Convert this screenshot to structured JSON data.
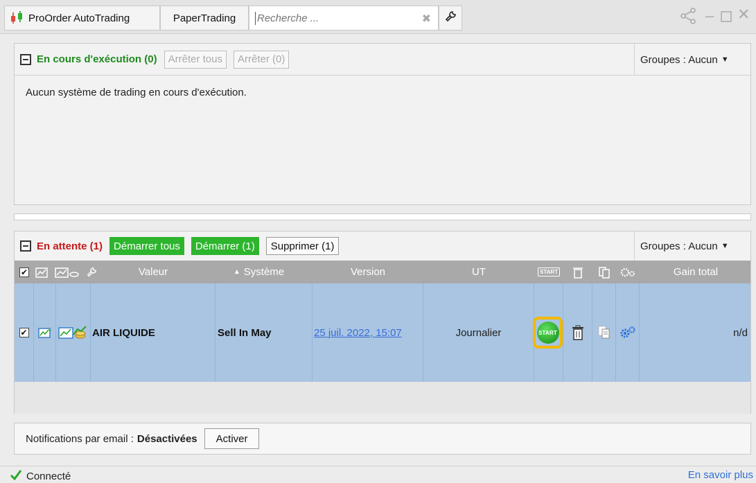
{
  "titlebar": {
    "tabs": [
      "ProOrder AutoTrading",
      "PaperTrading"
    ],
    "search_placeholder": "Recherche ...",
    "icons": [
      "candlestick-icon",
      "wrench-icon",
      "share-icon",
      "minimize-icon",
      "maximize-icon",
      "close-icon"
    ]
  },
  "running": {
    "title": "En cours d'exécution (0)",
    "stop_all_label": "Arrêter tous",
    "stop_label": "Arrêter (0)",
    "groups_label": "Groupes : Aucun",
    "empty_message": "Aucun système de trading en cours d'exécution."
  },
  "pending": {
    "title": "En attente (1)",
    "start_all_label": "Démarrer tous",
    "start_label": "Démarrer (1)",
    "delete_label": "Supprimer (1)",
    "groups_label": "Groupes : Aucun",
    "columns": {
      "valeur": "Valeur",
      "systeme": "Système",
      "version": "Version",
      "ut": "UT",
      "start_badge": "START",
      "gain": "Gain total"
    },
    "rows": [
      {
        "checked": true,
        "valeur": "AIR LIQUIDE",
        "systeme": "Sell In May",
        "version": "25 juil. 2022, 15:07",
        "ut": "Journalier",
        "start_label": "START",
        "gain": "n/d"
      }
    ]
  },
  "notifications": {
    "label": "Notifications par email :",
    "status": "Désactivées",
    "activate_label": "Activer"
  },
  "status": {
    "connection": "Connecté",
    "learn_more": "En savoir plus"
  },
  "colors": {
    "running_title": "#1e8a1e",
    "pending_title": "#c41a1a",
    "green_button": "#2db52d",
    "row_selected": "#a9c5e2",
    "highlight": "#f2b800"
  }
}
